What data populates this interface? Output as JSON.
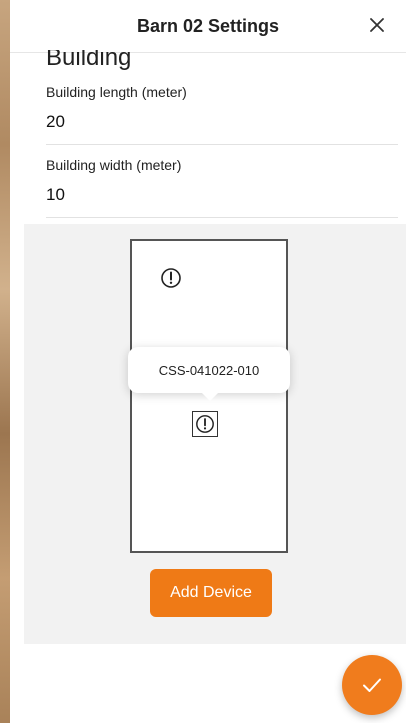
{
  "header": {
    "title": "Barn 02 Settings",
    "close_icon": "close-icon"
  },
  "building": {
    "section_title": "Building",
    "length_label": "Building length (meter)",
    "length_value": "20",
    "width_label": "Building width (meter)",
    "width_value": "10"
  },
  "diagram": {
    "tooltip_text": "CSS-041022-010",
    "device_icon": "alert-icon"
  },
  "actions": {
    "add_device_label": "Add Device",
    "confirm_icon": "checkmark-icon"
  },
  "colors": {
    "accent": "#ef7a16",
    "panel_background": "#f2f2f2"
  }
}
